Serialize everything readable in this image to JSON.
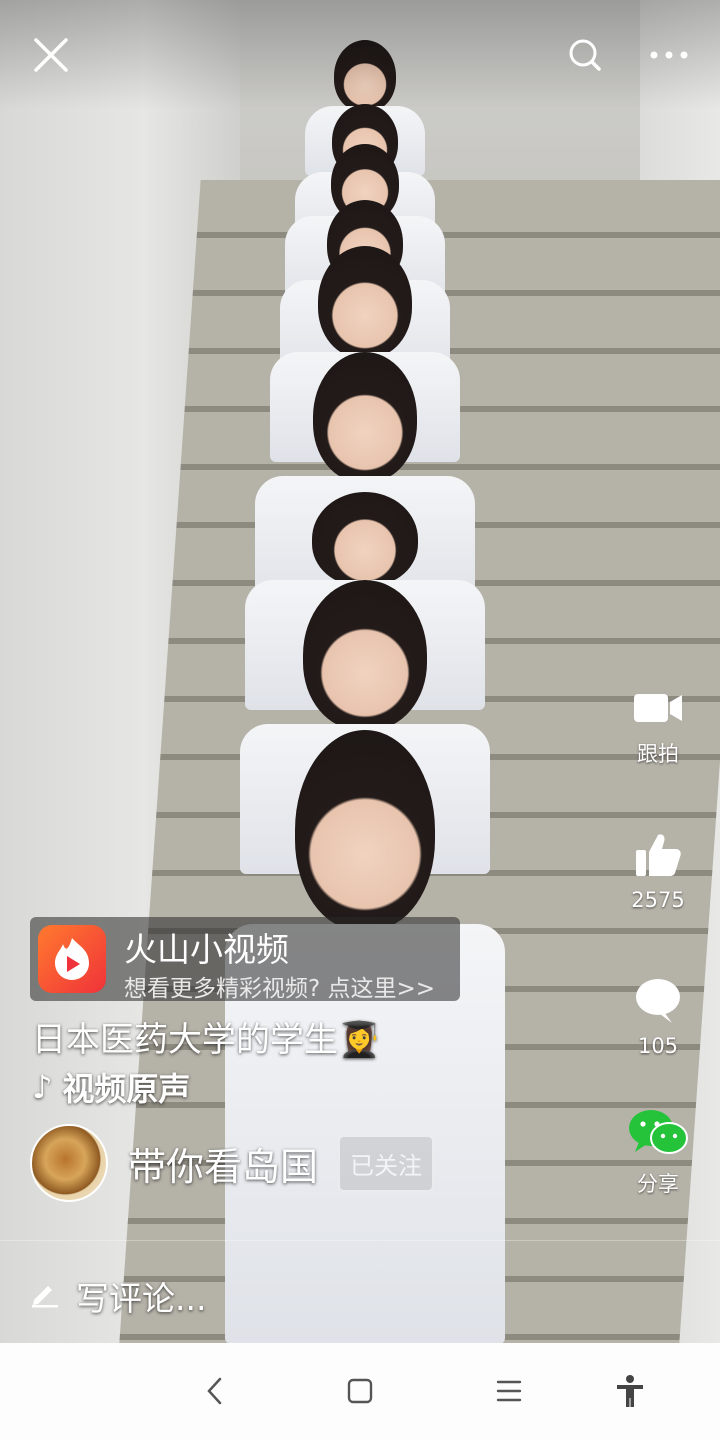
{
  "top_bar": {
    "close_icon": "close-icon",
    "search_icon": "search-icon",
    "more_icon": "more-icon"
  },
  "video": {
    "caption": "日本医药大学的学生",
    "caption_emoji": "👩‍🎓",
    "music_note": "♪",
    "music": "视频原声"
  },
  "promo": {
    "app_name": "火山小视频",
    "subtitle": "想看更多精彩视频? 点这里>>",
    "brand_color": "#f0323a"
  },
  "right_rail": {
    "shoot_label": "跟拍",
    "like_count": "2575",
    "comment_count": "105",
    "share_label": "分享",
    "share_icon_color": "#24c33a"
  },
  "author": {
    "name": "带你看岛国",
    "follow_label": "已关注"
  },
  "comment_bar": {
    "placeholder": "写评论..."
  },
  "system_nav": {
    "back_icon": "back-chevron-icon",
    "home_icon": "home-square-icon",
    "menu_icon": "menu-lines-icon",
    "accessibility_icon": "accessibility-icon"
  }
}
